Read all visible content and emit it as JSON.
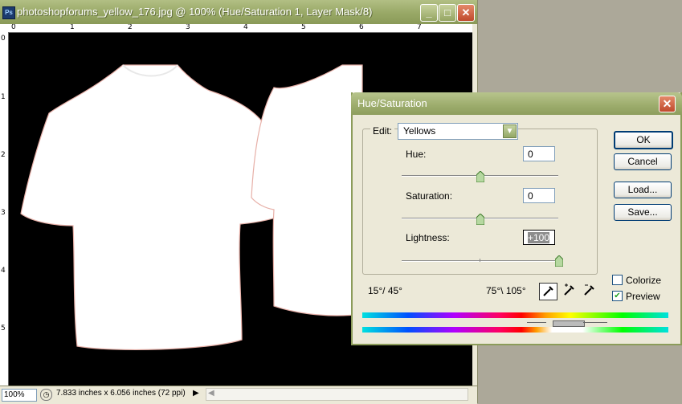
{
  "document": {
    "title": "photoshopforums_yellow_176.jpg @ 100% (Hue/Saturation 1, Layer Mask/8)",
    "app_icon_text": "Ps",
    "window_buttons": {
      "minimize": "_",
      "maximize": "□",
      "close": "✕"
    },
    "ruler_top": [
      "0",
      "1",
      "2",
      "3",
      "4",
      "5",
      "6",
      "7"
    ],
    "ruler_left": [
      "0",
      "1",
      "2",
      "3",
      "4",
      "5"
    ],
    "zoom": "100%",
    "status_info": "7.833 inches x 6.056 inches (72 ppi)"
  },
  "dialog": {
    "title": "Hue/Saturation",
    "edit_label": "Edit:",
    "edit_value": "Yellows",
    "hue_label": "Hue:",
    "hue_value": "0",
    "saturation_label": "Saturation:",
    "saturation_value": "0",
    "lightness_label": "Lightness:",
    "lightness_value": "+100",
    "range_left": "15°/ 45°",
    "range_right": "75°\\ 105°",
    "buttons": {
      "ok": "OK",
      "cancel": "Cancel",
      "load": "Load...",
      "save": "Save..."
    },
    "colorize_label": "Colorize",
    "colorize_checked": false,
    "preview_label": "Preview",
    "preview_checked": true,
    "sliders": {
      "hue": 0,
      "saturation": 0,
      "lightness": 100
    }
  },
  "colors": {
    "title_bar": "#98a866",
    "canvas": "#000000",
    "shirt": "#ffffff"
  }
}
